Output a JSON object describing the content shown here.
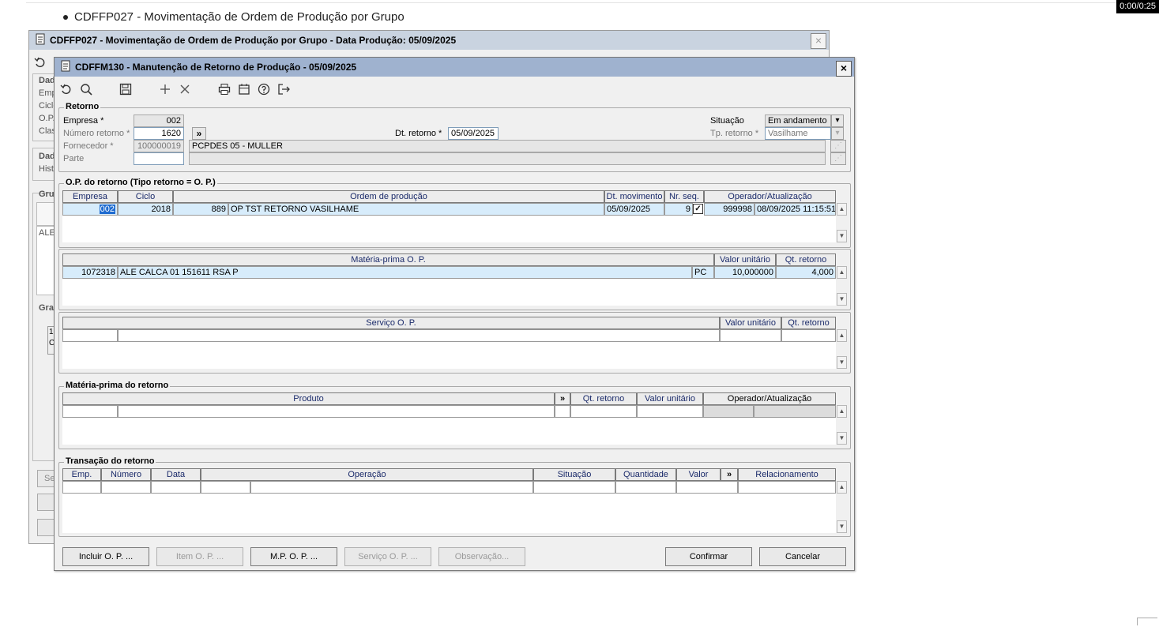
{
  "page": {
    "bullet_text": "CDFFP027 - Movimentação de Ordem de Produção por Grupo",
    "timer": "0:00/0:25"
  },
  "back_window": {
    "title": "CDFFP027 - Movimentação de Ordem de Produção por Grupo - Data Produção: 05/09/2025",
    "close": "×",
    "side_labels": [
      "Dad",
      "Emp",
      "Ciclo",
      "O.P.",
      "Clas",
      "Dad",
      "Histo",
      "Gru",
      "Gra"
    ],
    "ale_field": "ALE",
    "small_codes": [
      "1",
      "C"
    ],
    "button_se": "Se"
  },
  "window": {
    "title": "CDFFM130 - Manutenção de Retorno de Produção - 05/09/2025",
    "close": "×"
  },
  "toolbar": {
    "icons": [
      "refresh-icon",
      "search-icon",
      "save-icon",
      "add-icon",
      "delete-icon",
      "print-icon",
      "calendar-icon",
      "help-icon",
      "exit-icon"
    ]
  },
  "retorno": {
    "title": "Retorno",
    "empresa_label": "Empresa *",
    "empresa_value": "002",
    "numero_label": "Número retorno *",
    "numero_value": "1620",
    "expand": "»",
    "fornecedor_label": "Fornecedor *",
    "fornecedor_code": "100000019",
    "fornecedor_name": "PCPDES 05 - MULLER",
    "parte_label": "Parte",
    "parte_value": "",
    "dt_label": "Dt. retorno *",
    "dt_value": "05/09/2025",
    "situacao_label": "Situação",
    "situacao_value": "Em andamento",
    "tp_label": "Tp. retorno *",
    "tp_value": "Vasilhame"
  },
  "op_grid": {
    "title": "O.P. do retorno (Tipo retorno = O. P.)",
    "headers": [
      "Empresa",
      "Ciclo",
      "Ordem de produção",
      "Dt. movimento",
      "Nr. seq.",
      "Operador/Atualização"
    ],
    "row": {
      "empresa": "002",
      "ciclo": "2018",
      "op_num": "889",
      "op_desc": "OP TST RETORNO VASILHAME",
      "dt": "05/09/2025",
      "seq": "9",
      "checked": "✓",
      "operador": "999998",
      "atualizacao": "08/09/2025 11:15:51"
    }
  },
  "mp_grid": {
    "headers": [
      "Matéria-prima O. P.",
      "Valor unitário",
      "Qt. retorno"
    ],
    "row": {
      "code": "1072318",
      "desc": "ALE CALCA 01 151611 RSA P",
      "un": "PC",
      "valor": "10,000000",
      "qt": "4,000"
    }
  },
  "serv_grid": {
    "headers": [
      "Serviço O. P.",
      "Valor unitário",
      "Qt. retorno"
    ]
  },
  "mpr_grid": {
    "title": "Matéria-prima do retorno",
    "headers": [
      "Produto",
      "»",
      "Qt. retorno",
      "Valor unitário",
      "Operador/Atualização"
    ]
  },
  "trans_grid": {
    "title": "Transação do retorno",
    "headers": [
      "Emp.",
      "Número",
      "Data",
      "Operação",
      "Situação",
      "Quantidade",
      "Valor",
      "»",
      "Relacionamento"
    ]
  },
  "buttons": {
    "incluir_op": "Incluir O. P. ...",
    "item_op": "Item O. P. ...",
    "mp_op": "M.P. O. P. ...",
    "servico_op": "Serviço O. P. ...",
    "observacao": "Observação...",
    "confirmar": "Confirmar",
    "cancelar": "Cancelar"
  }
}
